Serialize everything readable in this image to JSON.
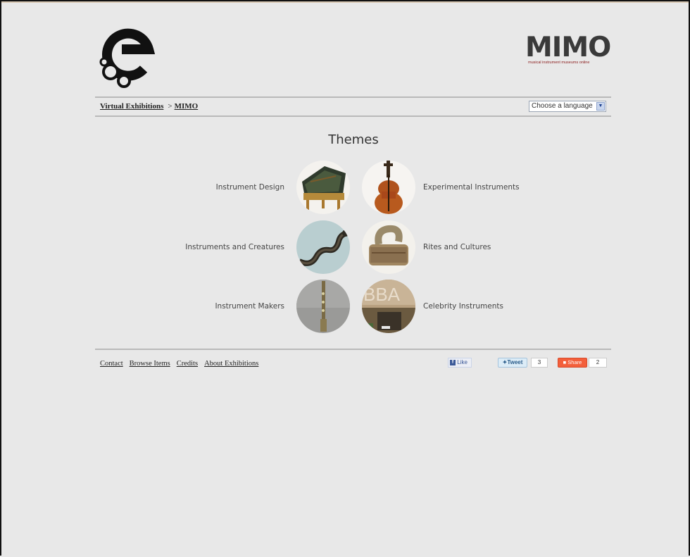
{
  "header": {
    "brand_title": "MIMO",
    "brand_subtitle": "musical instrument museums online"
  },
  "breadcrumb": {
    "root_label": "Virtual Exhibitions",
    "separator": ">",
    "current_label": "MIMO"
  },
  "language_select": {
    "selected_value": "Choose a language"
  },
  "main": {
    "title": "Themes",
    "themes": [
      {
        "label": "Instrument Design",
        "icon": "harpsichord-image"
      },
      {
        "label": "Experimental Instruments",
        "icon": "cello-image"
      },
      {
        "label": "Instruments and Creatures",
        "icon": "serpent-image"
      },
      {
        "label": "Rites and Cultures",
        "icon": "drum-image"
      },
      {
        "label": "Instrument Makers",
        "icon": "saxophone-image"
      },
      {
        "label": "Celebrity Instruments",
        "icon": "abba-image"
      }
    ]
  },
  "footer": {
    "links": [
      "Contact",
      "Browse Items",
      "Credits",
      "About Exhibitions"
    ],
    "like_label": "Like",
    "tweet_label": "Tweet",
    "tweet_count": "3",
    "share_label": "Share",
    "share_count": "2"
  },
  "colors": {
    "background": "#e8e8e8",
    "brand_text": "#3a3a3a",
    "share_orange": "#f35f3b",
    "facebook_blue": "#3b5998"
  }
}
